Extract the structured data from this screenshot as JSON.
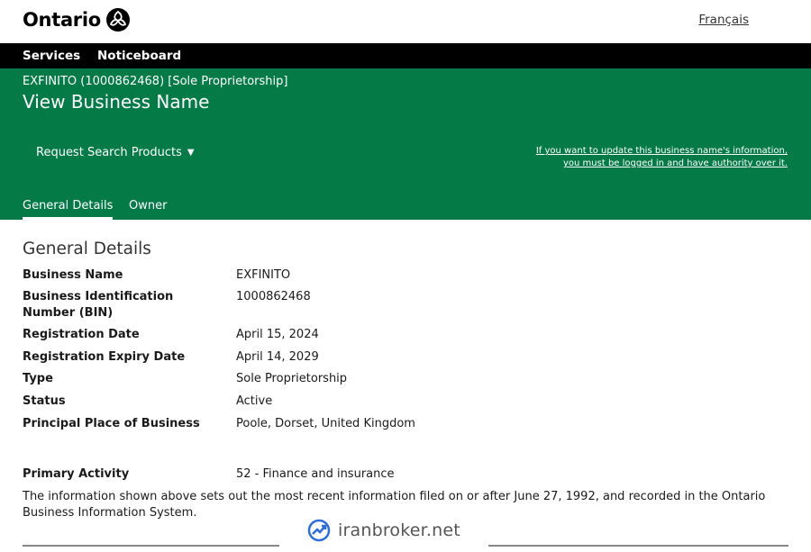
{
  "header": {
    "logo_text": "Ontario",
    "language_link": "Français"
  },
  "nav": {
    "services": "Services",
    "noticeboard": "Noticeboard"
  },
  "banner": {
    "business_subtitle": "EXFINITO (1000862468) [Sole Proprietorship]",
    "page_title": "View Business Name",
    "request_search_products": "Request Search Products",
    "update_note": "If you want to update this business name's information, you must be logged in and have authority over it.",
    "tabs": [
      "General Details",
      "Owner"
    ]
  },
  "section_title": "General Details",
  "details": [
    {
      "label": "Business Name",
      "value": "EXFINITO"
    },
    {
      "label": "Business Identification Number (BIN)",
      "value": "1000862468"
    },
    {
      "label": "Registration Date",
      "value": "April 15, 2024"
    },
    {
      "label": "Registration Expiry Date",
      "value": "April 14, 2029"
    },
    {
      "label": "Type",
      "value": "Sole Proprietorship"
    },
    {
      "label": "Status",
      "value": "Active"
    },
    {
      "label": "Principal Place of Business",
      "value": "Poole, Dorset, United Kingdom"
    },
    {
      "label": "Primary Activity",
      "value": "52 - Finance and insurance"
    }
  ],
  "footnote": "The information shown above sets out the most recent information filed on or after June 27, 1992, and recorded in the Ontario Business Information System.",
  "watermark": {
    "text": "iranbroker.net",
    "icon": "trend-chart-icon"
  },
  "colors": {
    "banner_green": "#047a47",
    "nav_black": "#000000"
  }
}
